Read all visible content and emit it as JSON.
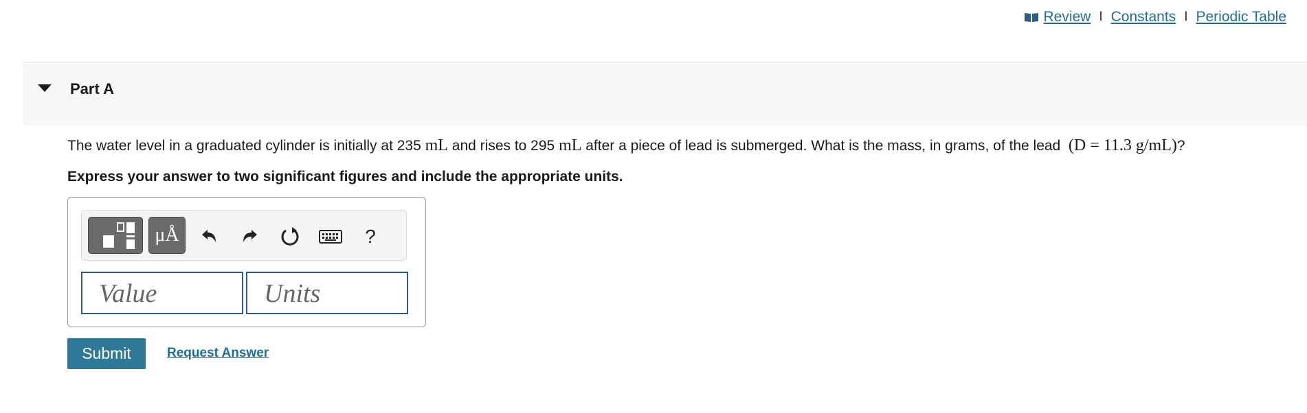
{
  "toplinks": {
    "review": " Review",
    "sep": "I",
    "constants": "Constants",
    "periodic_table": "Periodic Table",
    "icon": "book-icon"
  },
  "part": {
    "title": "Part A",
    "caret_icon": "caret-down-icon"
  },
  "question": {
    "t1": "The water level in a graduated cylinder is initially at 235 ",
    "u1": "mL",
    "t2": " and rises to 295 ",
    "u2": "mL",
    "t3": " after a piece of lead is submerged. What is the mass, in grams, of the lead ",
    "density": "(D = 11.3 g/mL)",
    "t4": "?"
  },
  "instruction": "Express your answer to two significant figures and include the appropriate units.",
  "toolbar": {
    "templates_icon": "templates-icon",
    "units_label": "μÅ",
    "undo_icon": "undo-icon",
    "redo_icon": "redo-icon",
    "reset_icon": "reset-icon",
    "keyboard_icon": "keyboard-icon",
    "help_label": "?"
  },
  "inputs": {
    "value_placeholder": "Value",
    "units_placeholder": "Units"
  },
  "buttons": {
    "submit": "Submit",
    "request_answer": "Request Answer"
  },
  "colors": {
    "link": "#1f6e96",
    "submit_bg": "#2f7898",
    "field_border": "#2d5a86"
  }
}
